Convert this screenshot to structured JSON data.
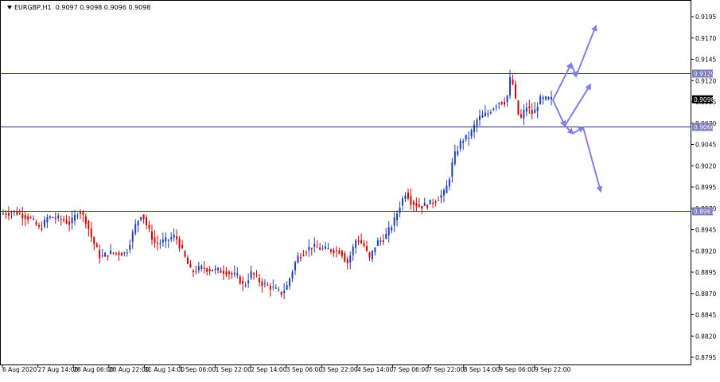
{
  "header": {
    "symbol": "EURGBP,H1",
    "ohlc": "0.9097 0.9098 0.9096 0.9098"
  },
  "chart_data": {
    "type": "candlestick",
    "ylim": [
      0.8795,
      0.9195
    ],
    "y_ticks": [
      "0.9195",
      "0.9170",
      "0.9145",
      "0.9120",
      "0.9095",
      "0.9070",
      "0.9045",
      "0.9020",
      "0.8995",
      "0.8970",
      "0.8945",
      "0.8920",
      "0.8895",
      "0.8870",
      "0.8845",
      "0.8820",
      "0.8795"
    ],
    "x_labels": [
      "6 Aug 2020",
      "27 Aug 14:00",
      "28 Aug 06:00",
      "28 Aug 22:00",
      "31 Aug 14:00",
      "1 Sep 06:00",
      "1 Sep 22:00",
      "2 Sep 14:00",
      "3 Sep 06:00",
      "3 Sep 22:00",
      "4 Sep 14:00",
      "7 Sep 06:00",
      "7 Sep 22:00",
      "8 Sep 14:00",
      "9 Sep 06:00",
      "9 Sep 22:00"
    ],
    "price_path": [
      [
        0,
        0.8963
      ],
      [
        20,
        0.8966
      ],
      [
        40,
        0.8958
      ],
      [
        52,
        0.8945
      ],
      [
        62,
        0.896
      ],
      [
        80,
        0.8957
      ],
      [
        90,
        0.8952
      ],
      [
        101,
        0.8968
      ],
      [
        110,
        0.8955
      ],
      [
        118,
        0.8932
      ],
      [
        128,
        0.8912
      ],
      [
        140,
        0.8918
      ],
      [
        160,
        0.8917
      ],
      [
        172,
        0.895
      ],
      [
        180,
        0.8965
      ],
      [
        188,
        0.8945
      ],
      [
        197,
        0.8928
      ],
      [
        210,
        0.8932
      ],
      [
        222,
        0.8938
      ],
      [
        232,
        0.8917
      ],
      [
        242,
        0.8895
      ],
      [
        255,
        0.89
      ],
      [
        265,
        0.8898
      ],
      [
        285,
        0.8896
      ],
      [
        300,
        0.889
      ],
      [
        308,
        0.8878
      ],
      [
        318,
        0.8895
      ],
      [
        330,
        0.8882
      ],
      [
        345,
        0.8876
      ],
      [
        355,
        0.887
      ],
      [
        362,
        0.8878
      ],
      [
        375,
        0.8912
      ],
      [
        392,
        0.8925
      ],
      [
        410,
        0.8922
      ],
      [
        430,
        0.892
      ],
      [
        438,
        0.8905
      ],
      [
        450,
        0.8935
      ],
      [
        460,
        0.8925
      ],
      [
        466,
        0.891
      ],
      [
        475,
        0.893
      ],
      [
        485,
        0.8935
      ],
      [
        497,
        0.8955
      ],
      [
        505,
        0.8975
      ],
      [
        512,
        0.899
      ],
      [
        518,
        0.8978
      ],
      [
        530,
        0.8972
      ],
      [
        540,
        0.8975
      ],
      [
        550,
        0.898
      ],
      [
        560,
        0.8988
      ],
      [
        565,
        0.9
      ],
      [
        572,
        0.903
      ],
      [
        582,
        0.905
      ],
      [
        592,
        0.9055
      ],
      [
        602,
        0.9075
      ],
      [
        615,
        0.9082
      ],
      [
        628,
        0.9095
      ],
      [
        638,
        0.9095
      ],
      [
        644,
        0.9128
      ],
      [
        650,
        0.9095
      ],
      [
        655,
        0.9072
      ],
      [
        663,
        0.909
      ],
      [
        672,
        0.908
      ],
      [
        680,
        0.9098
      ],
      [
        693,
        0.9098
      ]
    ],
    "candle_count": 200,
    "levels": [
      {
        "value": 0.9129,
        "label": "0.9129"
      },
      {
        "value": 0.9066,
        "label": "0.9066"
      },
      {
        "value": 0.8967,
        "label": "0.8967"
      }
    ],
    "current_price": {
      "value": 0.9098,
      "label": "0.9098"
    },
    "annotations": [
      {
        "type": "arrow",
        "from": [
          695,
          0.9097
        ],
        "to": [
          718,
          0.914
        ]
      },
      {
        "type": "arrow",
        "from": [
          718,
          0.914
        ],
        "to": [
          724,
          0.9125
        ]
      },
      {
        "type": "arrow",
        "from": [
          724,
          0.9125
        ],
        "to": [
          749,
          0.9184
        ]
      },
      {
        "type": "arrow",
        "from": [
          695,
          0.9097
        ],
        "to": [
          710,
          0.9067
        ]
      },
      {
        "type": "arrow",
        "from": [
          710,
          0.9067
        ],
        "to": [
          742,
          0.9115
        ]
      },
      {
        "type": "arrow",
        "from": [
          710,
          0.9067
        ],
        "to": [
          720,
          0.9058
        ]
      },
      {
        "type": "arrow",
        "from": [
          720,
          0.9058
        ],
        "to": [
          733,
          0.9065
        ]
      },
      {
        "type": "arrow",
        "from": [
          733,
          0.9065
        ],
        "to": [
          755,
          0.899
        ]
      }
    ],
    "colors": {
      "bull": "#1f3fb7",
      "bear": "#d00000",
      "level": "#2b2b8f",
      "arrow": "#7f7fef",
      "label_bg": "#7a7ab8"
    }
  }
}
